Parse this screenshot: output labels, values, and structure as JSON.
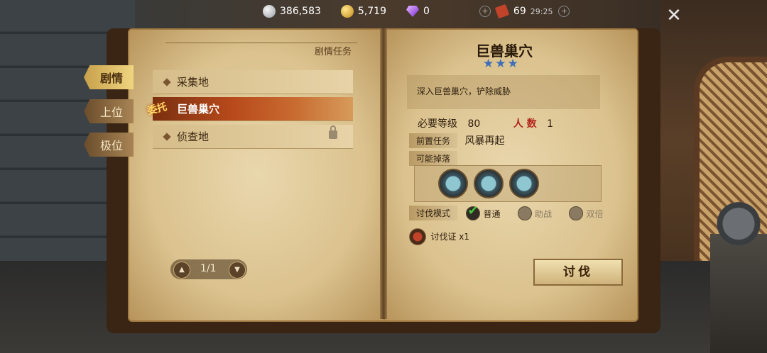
{
  "resources": {
    "silver": "386,583",
    "gold": "5,719",
    "gems": "0",
    "tickets": "69",
    "timer": "29:25"
  },
  "tabs": [
    {
      "label": "剧情",
      "active": true
    },
    {
      "label": "上位",
      "active": false
    },
    {
      "label": "极位",
      "active": false
    }
  ],
  "left_page": {
    "header": "剧情任务",
    "quests": [
      {
        "label": "采集地",
        "selected": false,
        "locked": false
      },
      {
        "label": "巨兽巢穴",
        "selected": true,
        "locked": false,
        "badge": "委托"
      },
      {
        "label": "侦查地",
        "selected": false,
        "locked": true
      }
    ],
    "pagination": "1/1"
  },
  "detail": {
    "title": "巨兽巢穴",
    "stars": "★★★",
    "description": "深入巨兽巢穴，铲除威胁",
    "level_label": "必要等级",
    "level_value": "80",
    "party_label": "人 数",
    "party_value": "1",
    "prereq_label": "前置任务",
    "prereq_value": "风暴再起",
    "drops_label": "可能掉落",
    "drops": [
      "drop-crystal-icon",
      "drop-shard-icon",
      "drop-claw-icon"
    ],
    "mode_label": "讨伐模式",
    "modes": [
      {
        "label": "普通",
        "selected": true
      },
      {
        "label": "助战",
        "selected": false
      },
      {
        "label": "双倍",
        "selected": false
      }
    ],
    "cost_item": "讨伐证 x1",
    "fight_button": "讨伐"
  }
}
